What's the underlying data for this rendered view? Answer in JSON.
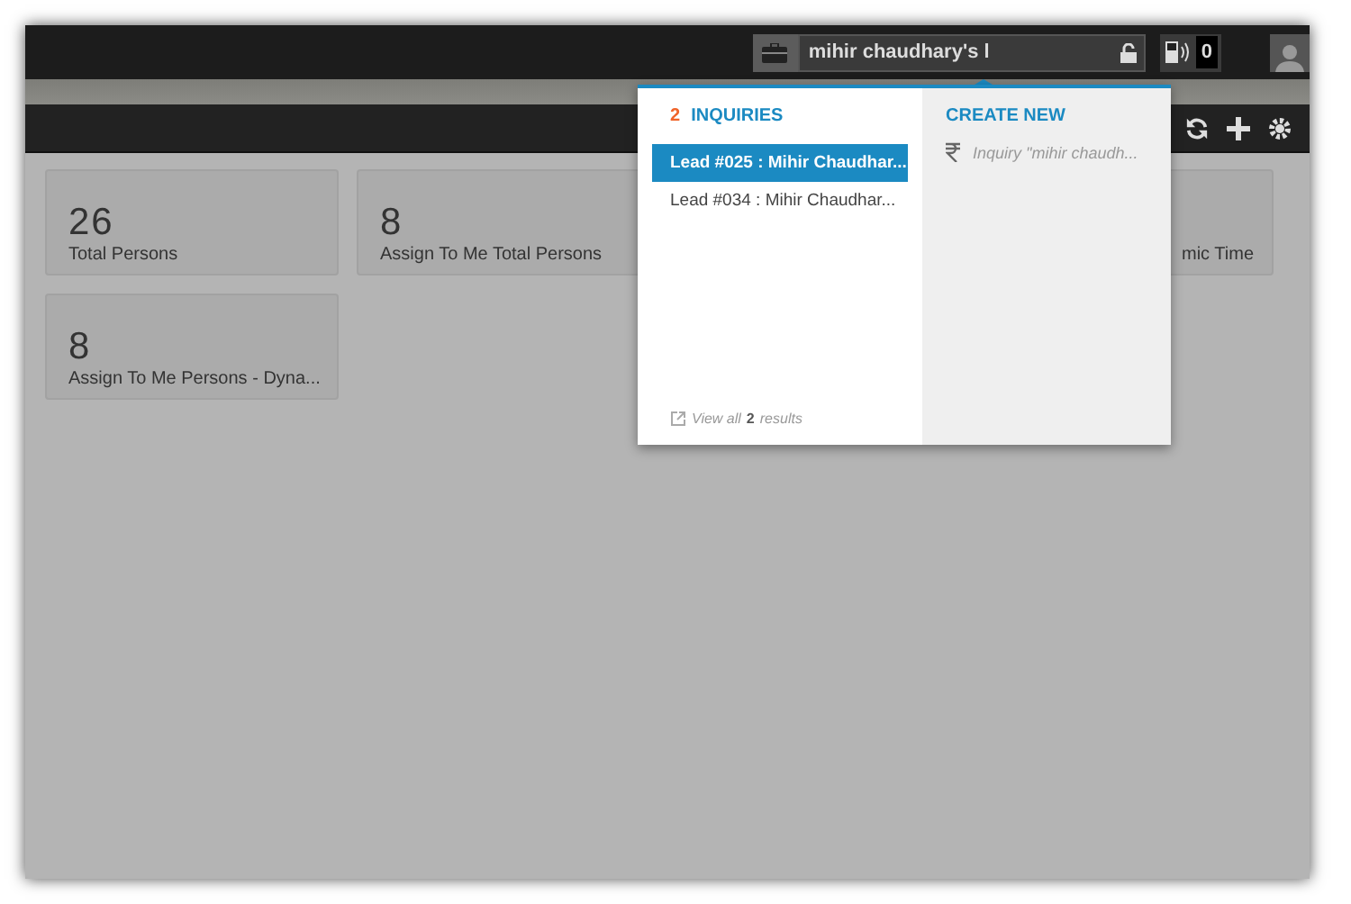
{
  "topbar": {
    "search_value": "mihir chaudhary's l",
    "calls_count": "0"
  },
  "cards": [
    {
      "value": "26",
      "label": "Total Persons"
    },
    {
      "value": "8",
      "label": "Assign To Me Total Persons"
    },
    {
      "label": "mic Time"
    },
    {
      "value": "8",
      "label": "Assign To Me Persons - Dyna..."
    }
  ],
  "dropdown": {
    "count": "2",
    "heading": "INQUIRIES",
    "results": [
      {
        "text": "Lead #025 : Mihir Chaudhar...",
        "selected": true
      },
      {
        "text": "Lead #034 : Mihir Chaudhar...",
        "selected": false
      }
    ],
    "view_all": {
      "prefix": "View all",
      "count": "2",
      "suffix": "results"
    },
    "create_heading": "CREATE NEW",
    "create_item": "Inquiry \"mihir chaudh..."
  }
}
